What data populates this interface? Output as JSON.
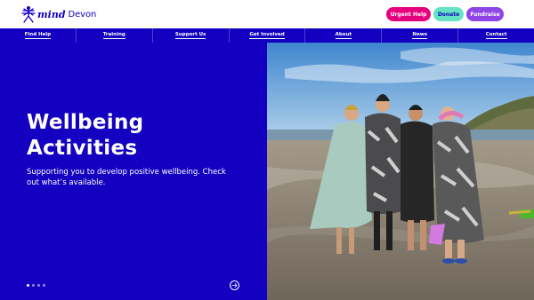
{
  "brand": {
    "logo_name": "mind",
    "logo_location": "Devon"
  },
  "header": {
    "buttons": {
      "urgent_help": "Urgent Help",
      "donate": "Donate",
      "fundraise": "Fundraise"
    }
  },
  "nav": {
    "items": [
      {
        "label": "Find Help"
      },
      {
        "label": "Training"
      },
      {
        "label": "Support Us"
      },
      {
        "label": "Get Involved"
      },
      {
        "label": "About"
      },
      {
        "label": "News"
      },
      {
        "label": "Contact"
      }
    ]
  },
  "hero": {
    "title_line1": "Wellbeing",
    "title_line2": "Activities",
    "subtitle": "Supporting you to develop positive wellbeing. Check out what’s available.",
    "carousel_slides": 4,
    "carousel_active": 0,
    "next_icon": "arrow-right-icon",
    "image_icon": "beach-photo"
  },
  "colors": {
    "primary_blue": "#1300c1",
    "urgent_pink": "#e5007e",
    "donate_mint": "#66e3c4",
    "fundraise_purple": "#8f44e6"
  }
}
